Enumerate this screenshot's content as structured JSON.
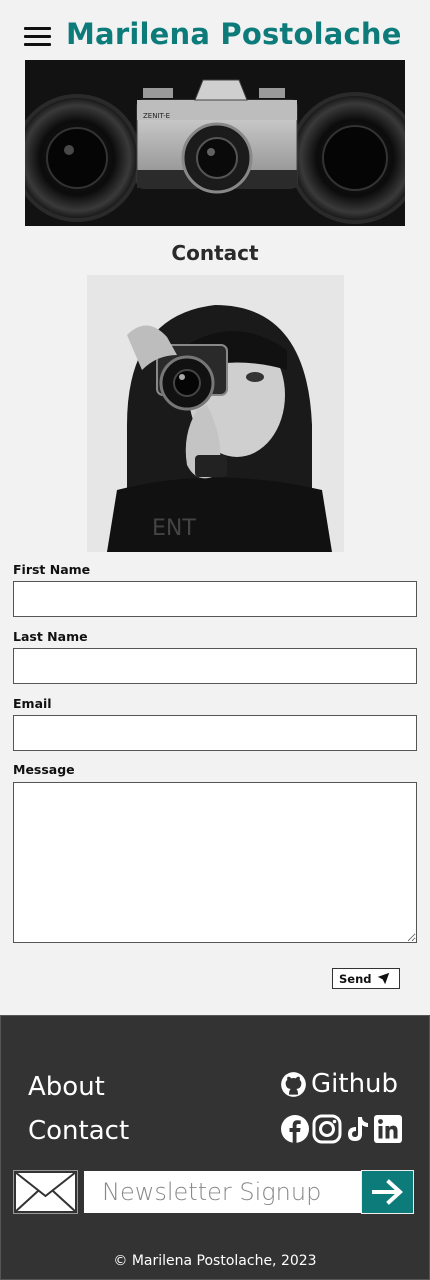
{
  "header": {
    "title": "Marilena Postolache"
  },
  "page": {
    "heading": "Contact"
  },
  "form": {
    "first_name_label": "First Name",
    "last_name_label": "Last Name",
    "email_label": "Email",
    "message_label": "Message",
    "send_label": "Send"
  },
  "banner": {
    "camera_label": "ZENIT-E"
  },
  "footer": {
    "links": [
      "About",
      "Contact"
    ],
    "github_label": "Github",
    "social_icons": [
      "facebook-icon",
      "instagram-icon",
      "tiktok-icon",
      "linkedin-icon"
    ],
    "newsletter_placeholder": "Newsletter Signup",
    "copyright": "© Marilena Postolache, 2023"
  },
  "colors": {
    "brand": "#0e7b7b",
    "footer_bg": "#333333",
    "page_bg": "#f2f2f2"
  }
}
